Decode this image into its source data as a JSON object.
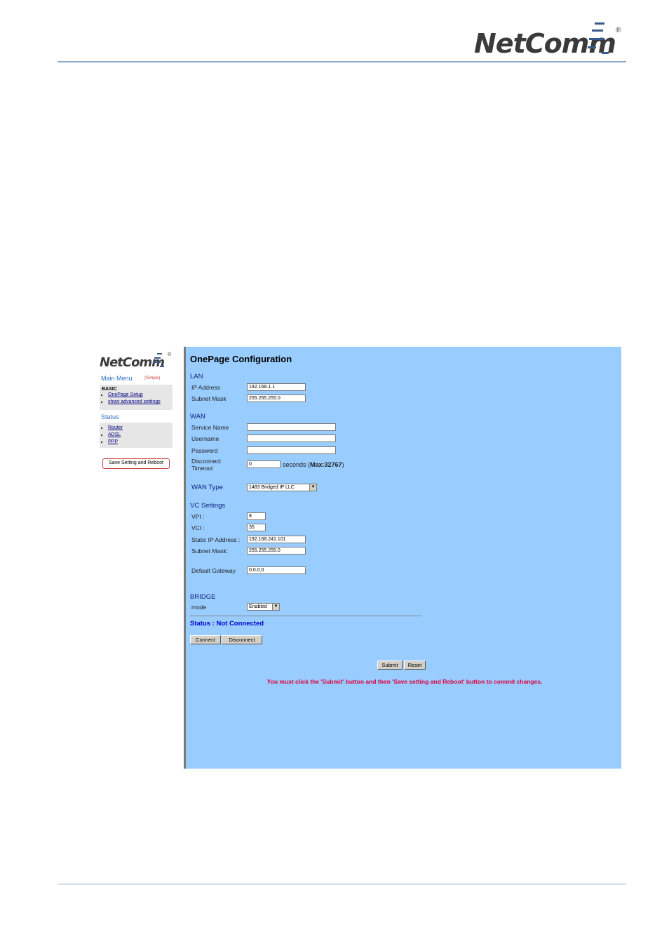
{
  "header": {
    "brand": "NetComm",
    "reg": "®"
  },
  "sidebar": {
    "brand": "NetComm",
    "reg": "®",
    "main_menu": "Main Menu",
    "mode_tag": "(Simple)",
    "basic_heading": "BASIC",
    "basic_items": [
      {
        "label": "OnePage Setup"
      },
      {
        "label": "show advanced settings"
      }
    ],
    "status_heading": "Status",
    "status_items": [
      {
        "label": "Router"
      },
      {
        "label": "ADSL"
      },
      {
        "label": "PPP"
      }
    ],
    "save_button": "Save Setting and Reboot"
  },
  "main": {
    "title": "OnePage Configuration",
    "lan": {
      "heading": "LAN",
      "ip_label": "IP Address",
      "ip_value": "192.168.1.1",
      "mask_label": "Subnet Mask",
      "mask_value": "255.255.255.0"
    },
    "wan": {
      "heading": "WAN",
      "service_label": "Service Name",
      "service_value": "",
      "username_label": "Username",
      "username_value": "",
      "password_label": "Password",
      "password_value": "",
      "timeout_label_1": "Disconnect",
      "timeout_label_2": "Timeout",
      "timeout_value": "0",
      "seconds_text": "seconds (",
      "max_text": "Max:32767",
      "close_paren": ")"
    },
    "wan_type": {
      "label": "WAN Type",
      "selected": "1483 Bridged IP LLC"
    },
    "vc": {
      "heading": "VC Settings",
      "vpi_label": "VPI :",
      "vpi_value": "8",
      "vci_label": "VCI :",
      "vci_value": "35",
      "static_ip_label": "Static IP Address :",
      "static_ip_value": "192.168.241.101",
      "mask_label": "Subnet Mask:",
      "mask_value": "255.255.255.0",
      "gateway_label": "Default Gateway",
      "gateway_value": "0.0.0.0"
    },
    "bridge": {
      "heading": "BRIDGE",
      "mode_label": "mode",
      "mode_selected": "Enabled"
    },
    "status_text": "Status : Not Connected",
    "connect_button": "Connect",
    "disconnect_button": "Disconnect",
    "submit_button": "Submit",
    "reset_button": "Reset",
    "warning": "You must click the 'Submit' button and then 'Save setting and Reboot' button to commit changes."
  }
}
